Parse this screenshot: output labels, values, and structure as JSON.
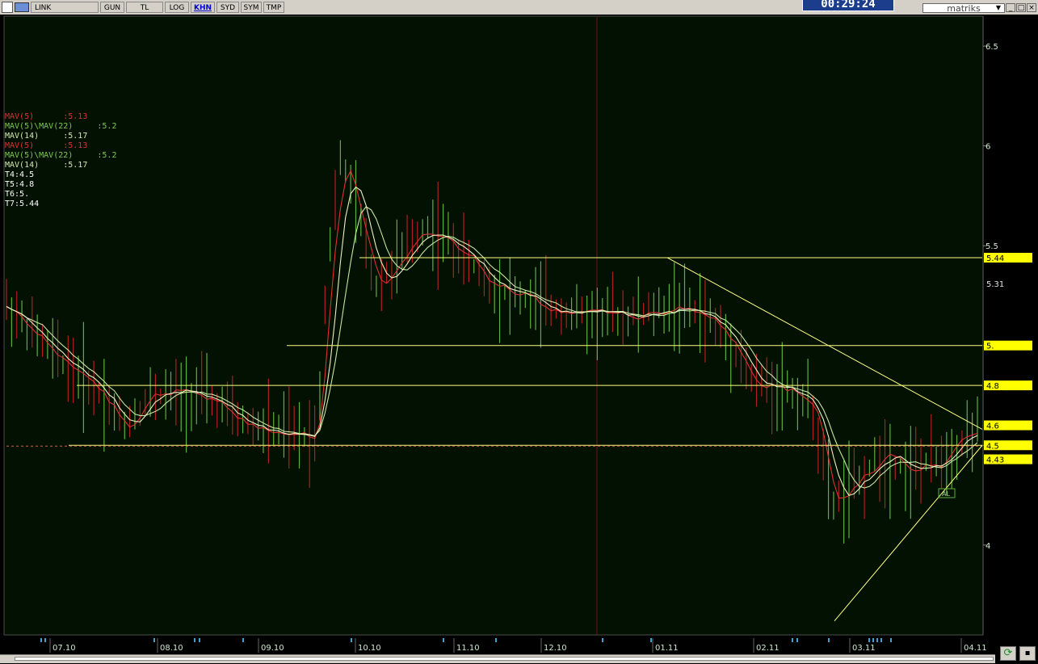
{
  "toolbar": {
    "buttons": [
      "LINK",
      "GUN",
      "TL",
      "LOG",
      "KHN",
      "SYD",
      "SYM",
      "TMP"
    ],
    "active": "KHN"
  },
  "clock": "00:29:24",
  "logo": "matriks",
  "window": {
    "minimize": "_",
    "maximize": "□",
    "close": "×"
  },
  "legend": [
    {
      "text": "MAV(5)      :5.13",
      "color": "#e03030"
    },
    {
      "text": "MAV(5)\\MAV(22)     :5.2",
      "color": "#7ec850"
    },
    {
      "text": "MAV(14)     :5.17",
      "color": "#d8e8b0"
    },
    {
      "text": "MAV(5)      :5.13",
      "color": "#e03030"
    },
    {
      "text": "MAV(5)\\MAV(22)     :5.2",
      "color": "#7ec850"
    },
    {
      "text": "MAV(14)     :5.17",
      "color": "#d8e8b0"
    },
    {
      "text": "T4:4.5",
      "color": "#ffffff"
    },
    {
      "text": "T5:4.8",
      "color": "#ffffff"
    },
    {
      "text": "T6:5.",
      "color": "#ffffff"
    },
    {
      "text": "T7:5.44",
      "color": "#ffffff"
    }
  ],
  "chart_data": {
    "type": "bar",
    "ylim": [
      3.55,
      6.65
    ],
    "y_ticks": [
      {
        "value": 6.5,
        "label": "6.5"
      },
      {
        "value": 6,
        "label": "6"
      },
      {
        "value": 5.5,
        "label": "5.5"
      },
      {
        "value": 5,
        "label": "5"
      },
      {
        "value": 4.5,
        "label": "4.5"
      },
      {
        "value": 4,
        "label": "4"
      }
    ],
    "x_labels": [
      "07.10",
      "08.10",
      "09.10",
      "10.10",
      "11.10",
      "12.10",
      "01.11",
      "02.11",
      "03.11",
      "04.11"
    ],
    "price_badges": [
      {
        "value": 5.44,
        "label": "5.44",
        "style": "yellow"
      },
      {
        "value": 5.31,
        "label": "5.31",
        "style": "plain"
      },
      {
        "value": 5.0,
        "label": "5.",
        "style": "yellow"
      },
      {
        "value": 4.8,
        "label": "4.8",
        "style": "yellow"
      },
      {
        "value": 4.6,
        "label": "4.6",
        "style": "yellow"
      },
      {
        "value": 4.5,
        "label": "4.5",
        "style": "yellow"
      },
      {
        "value": 4.43,
        "label": "4.43",
        "style": "yellow"
      }
    ],
    "h_lines": [
      5.44,
      5.0,
      4.8,
      4.5
    ],
    "signal_label": "AL",
    "colors": {
      "background": "#021102",
      "up_bar": "#5fb040",
      "down_bar": "#b02020",
      "mav5": "#e03030",
      "mav22": "#c8e6a0",
      "mav14": "#f0f0c0",
      "level_line": "#ffff80",
      "dotted": "#d06040"
    }
  }
}
